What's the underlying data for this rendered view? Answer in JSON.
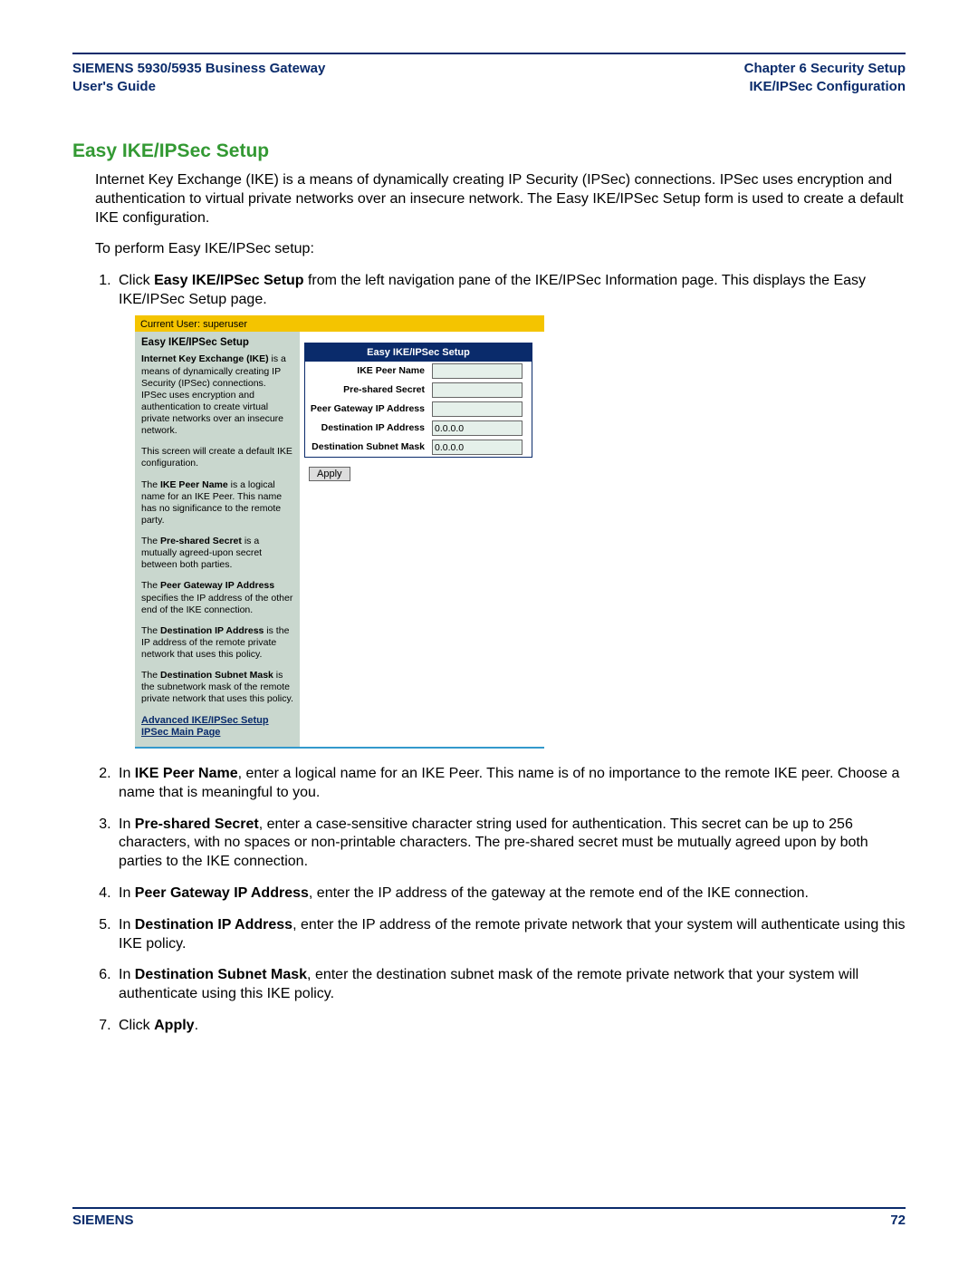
{
  "header": {
    "left_line1": "SIEMENS 5930/5935 Business Gateway",
    "left_line2": "User's Guide",
    "right_line1": "Chapter 6  Security Setup",
    "right_line2": "IKE/IPSec Configuration"
  },
  "section_title": "Easy IKE/IPSec Setup",
  "intro_para": "Internet Key Exchange (IKE) is a means of dynamically creating IP Security (IPSec) connections. IPSec uses encryption and authentication to virtual private networks over an insecure network. The Easy IKE/IPSec Setup form is used to create a default IKE configuration.",
  "lead_in": "To perform Easy IKE/IPSec setup:",
  "steps": {
    "s1_a": "Click ",
    "s1_b": "Easy IKE/IPSec Setup",
    "s1_c": " from the left navigation pane of the IKE/IPSec Information page. This displays the Easy IKE/IPSec Setup page.",
    "s2_a": "In ",
    "s2_b": "IKE Peer Name",
    "s2_c": ", enter a logical name for an IKE Peer. This name is of no importance to the remote IKE peer. Choose a name that is meaningful to you.",
    "s3_a": "In ",
    "s3_b": "Pre-shared Secret",
    "s3_c": ", enter a case-sensitive character string used for authentication. This secret can be up to 256 characters, with no spaces or non-printable characters. The pre-shared secret must be mutually agreed upon by both parties to the IKE connection.",
    "s4_a": "In ",
    "s4_b": "Peer Gateway IP Address",
    "s4_c": ", enter the IP address of the gateway at the remote end of the IKE connection.",
    "s5_a": "In ",
    "s5_b": "Destination IP Address",
    "s5_c": ", enter the IP address of the remote private network that your system will authenticate using this IKE policy.",
    "s6_a": "In ",
    "s6_b": "Destination Subnet Mask",
    "s6_c": ", enter the destination subnet mask of the remote private network that your system will authenticate using this IKE policy.",
    "s7_a": "Click ",
    "s7_b": "Apply",
    "s7_c": "."
  },
  "shot": {
    "userbar": "Current User: superuser",
    "side_title": "Easy IKE/IPSec Setup",
    "side_p1_a": "Internet Key Exchange (IKE)",
    "side_p1_b": " is a means of dynamically creating IP Security (IPSec) connections. IPSec uses encryption and authentication to create virtual private networks over an insecure network.",
    "side_p2": "This screen will create a default IKE configuration.",
    "side_p3_a": "The ",
    "side_p3_b": "IKE Peer Name",
    "side_p3_c": " is a logical name for an IKE Peer. This name has no significance to the remote party.",
    "side_p4_a": "The ",
    "side_p4_b": "Pre-shared Secret",
    "side_p4_c": " is a mutually agreed-upon secret between both parties.",
    "side_p5_a": "The ",
    "side_p5_b": "Peer Gateway IP Address",
    "side_p5_c": " specifies the IP address of the other end of the IKE connection.",
    "side_p6_a": "The ",
    "side_p6_b": "Destination IP Address",
    "side_p6_c": " is the IP address of the remote private network that uses this policy.",
    "side_p7_a": "The ",
    "side_p7_b": "Destination Subnet Mask",
    "side_p7_c": " is the subnetwork mask of the remote private network that uses this policy.",
    "side_link1": "Advanced IKE/IPSec Setup",
    "side_link2": "IPSec Main Page",
    "form_title": "Easy IKE/IPSec Setup",
    "lbl_peer": "IKE Peer Name",
    "lbl_secret": "Pre-shared Secret",
    "lbl_gw": "Peer Gateway IP Address",
    "lbl_dip": "Destination IP Address",
    "lbl_mask": "Destination Subnet Mask",
    "val_peer": "",
    "val_secret": "",
    "val_gw": "",
    "val_dip": "0.0.0.0",
    "val_mask": "0.0.0.0",
    "apply": "Apply"
  },
  "footer": {
    "brand": "SIEMENS",
    "page": "72"
  }
}
